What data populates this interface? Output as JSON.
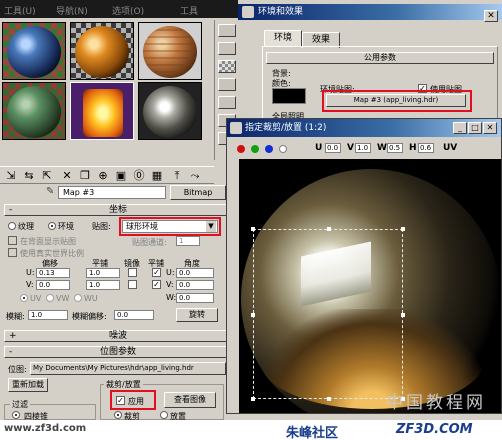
{
  "material_editor": {
    "menu": [
      "工具(U)",
      "导航(N)",
      "选项(O)",
      "工具"
    ],
    "material_name": "Map #3",
    "material_type": "Bitmap",
    "coords_rollout": {
      "title": "坐标",
      "texture_label": "纹理",
      "environ_label": "环境",
      "mapping_label": "贴图:",
      "mapping_value": "球形环境",
      "show_on_background": "在背面显示贴图",
      "map_channel_label": "贴图通道:",
      "map_channel_value": "1",
      "real_world": "使用真实世界比例",
      "offset_header": "偏移",
      "tiling_header": "平铺",
      "mirror_header": "镜像",
      "tile_header": "平铺",
      "angle_header": "角度",
      "u_label": "U:",
      "v_label": "V:",
      "w_label": "W:",
      "u_offset": "0.13",
      "v_offset": "0.0",
      "u_tiling": "1.0",
      "v_tiling": "1.0",
      "u_angle": "0.0",
      "v_angle": "0.0",
      "w_angle": "0.0",
      "uv_radio": "UV",
      "vw_radio": "VW",
      "wu_radio": "WU",
      "blur_label": "模糊:",
      "blur_value": "1.0",
      "blur_offset_label": "模糊偏移:",
      "blur_offset_value": "0.0",
      "rotate_button": "旋转"
    },
    "noise_rollout": {
      "title": "噪波"
    },
    "bitmap_rollout": {
      "title": "位图参数",
      "bitmap_label": "位图:",
      "bitmap_path": "My Documents\\My Pictures\\hdr\\app_living.hdr",
      "reload_button": "重新加载",
      "crop_group_label": "裁剪/放置",
      "apply_label": "应用",
      "view_image_button": "查看图像",
      "filter_label": "过滤",
      "pyramid_label": "四棱锥",
      "crop_radio": "裁剪",
      "place_radio": "放置"
    }
  },
  "environment_dialog": {
    "title": "环境和效果",
    "tabs": [
      "环境",
      "效果"
    ],
    "section": "公用参数",
    "background_label": "背景:",
    "color_label": "颜色:",
    "env_map_label": "环境贴图:",
    "use_map_label": "使用贴图",
    "map_button": "Map #3 (app_living.hdr)",
    "exposure_label": "全局照明"
  },
  "crop_window": {
    "title": "指定裁剪/放置 (1:2)",
    "u_label": "U",
    "u_value": "0.0",
    "v_label": "V",
    "v_value": "1.0",
    "w_label": "W",
    "w_value": "0.5",
    "h_label": "H",
    "h_value": "0.6",
    "uv_label": "UV",
    "channel_colors": [
      "#d01010",
      "#10a010",
      "#1030d0",
      "#ffffff"
    ]
  },
  "footer": {
    "left_url": "www.zf3d.com",
    "center_brand": "朱峰社区",
    "right_brand": "ZF3D.COM",
    "watermark": "中国教程网"
  },
  "colors": {
    "highlight_red": "#e01020",
    "title_blue": "#0a246a"
  }
}
